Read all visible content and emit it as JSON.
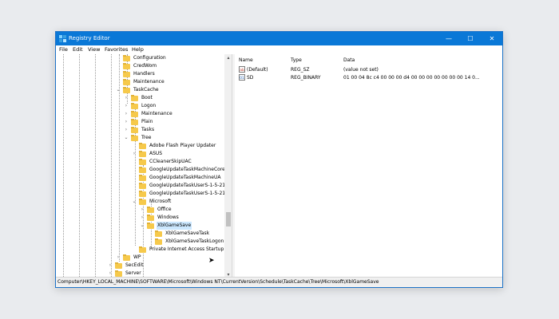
{
  "window": {
    "title": "Registry Editor",
    "controls": {
      "minimize": "—",
      "maximize": "☐",
      "close": "✕"
    }
  },
  "menu": [
    "File",
    "Edit",
    "View",
    "Favorites",
    "Help"
  ],
  "tree": [
    {
      "label": "Configuration"
    },
    {
      "label": "CredWom"
    },
    {
      "label": "Handlers"
    },
    {
      "label": "Maintenance"
    },
    {
      "label": "TaskCache",
      "expander": "⌄"
    },
    {
      "label": "Boot",
      "expander": "›"
    },
    {
      "label": "Logon",
      "expander": "›"
    },
    {
      "label": "Maintenance",
      "expander": "›"
    },
    {
      "label": "Plain",
      "expander": "›"
    },
    {
      "label": "Tasks",
      "expander": "›"
    },
    {
      "label": "Tree",
      "expander": "⌄"
    },
    {
      "label": "Adobe Flash Player Updater"
    },
    {
      "label": "ASUS",
      "expander": "›"
    },
    {
      "label": "CCleanerSkipUAC"
    },
    {
      "label": "GoogleUpdateTaskMachineCore"
    },
    {
      "label": "GoogleUpdateTaskMachineUA"
    },
    {
      "label": "GoogleUpdateTaskUserS-1-5-21-"
    },
    {
      "label": "GoogleUpdateTaskUserS-1-5-21-"
    },
    {
      "label": "Microsoft",
      "expander": "⌄"
    },
    {
      "label": "Office",
      "expander": "›"
    },
    {
      "label": "Windows",
      "expander": "›"
    },
    {
      "label": "XblGameSave",
      "expander": "⌄"
    },
    {
      "label": "XblGameSaveTask"
    },
    {
      "label": "XblGameSaveTaskLogon"
    },
    {
      "label": "Private Internet Access Startup"
    },
    {
      "label": "WP",
      "expander": "›"
    },
    {
      "label": "SecEdit",
      "expander": "›"
    },
    {
      "label": "Server",
      "expander": "›"
    }
  ],
  "values": {
    "columns": [
      "Name",
      "Type",
      "Data"
    ],
    "rows": [
      {
        "icon": "ab",
        "name": "(Default)",
        "type": "REG_SZ",
        "data": "(value not set)"
      },
      {
        "icon": "01",
        "name": "SD",
        "type": "REG_BINARY",
        "data": "01 00 04 8c c4 00 00 00 d4 00 00 00 00 00 00 00 14 0..."
      }
    ]
  },
  "statusbar": "Computer\\HKEY_LOCAL_MACHINE\\SOFTWARE\\Microsoft\\Windows NT\\CurrentVersion\\Schedule\\TaskCache\\Tree\\Microsoft\\XblGameSave",
  "colors": {
    "titlebar": "#0a78d7",
    "selection": "#cce8ff",
    "folder": "#f6c94b"
  }
}
